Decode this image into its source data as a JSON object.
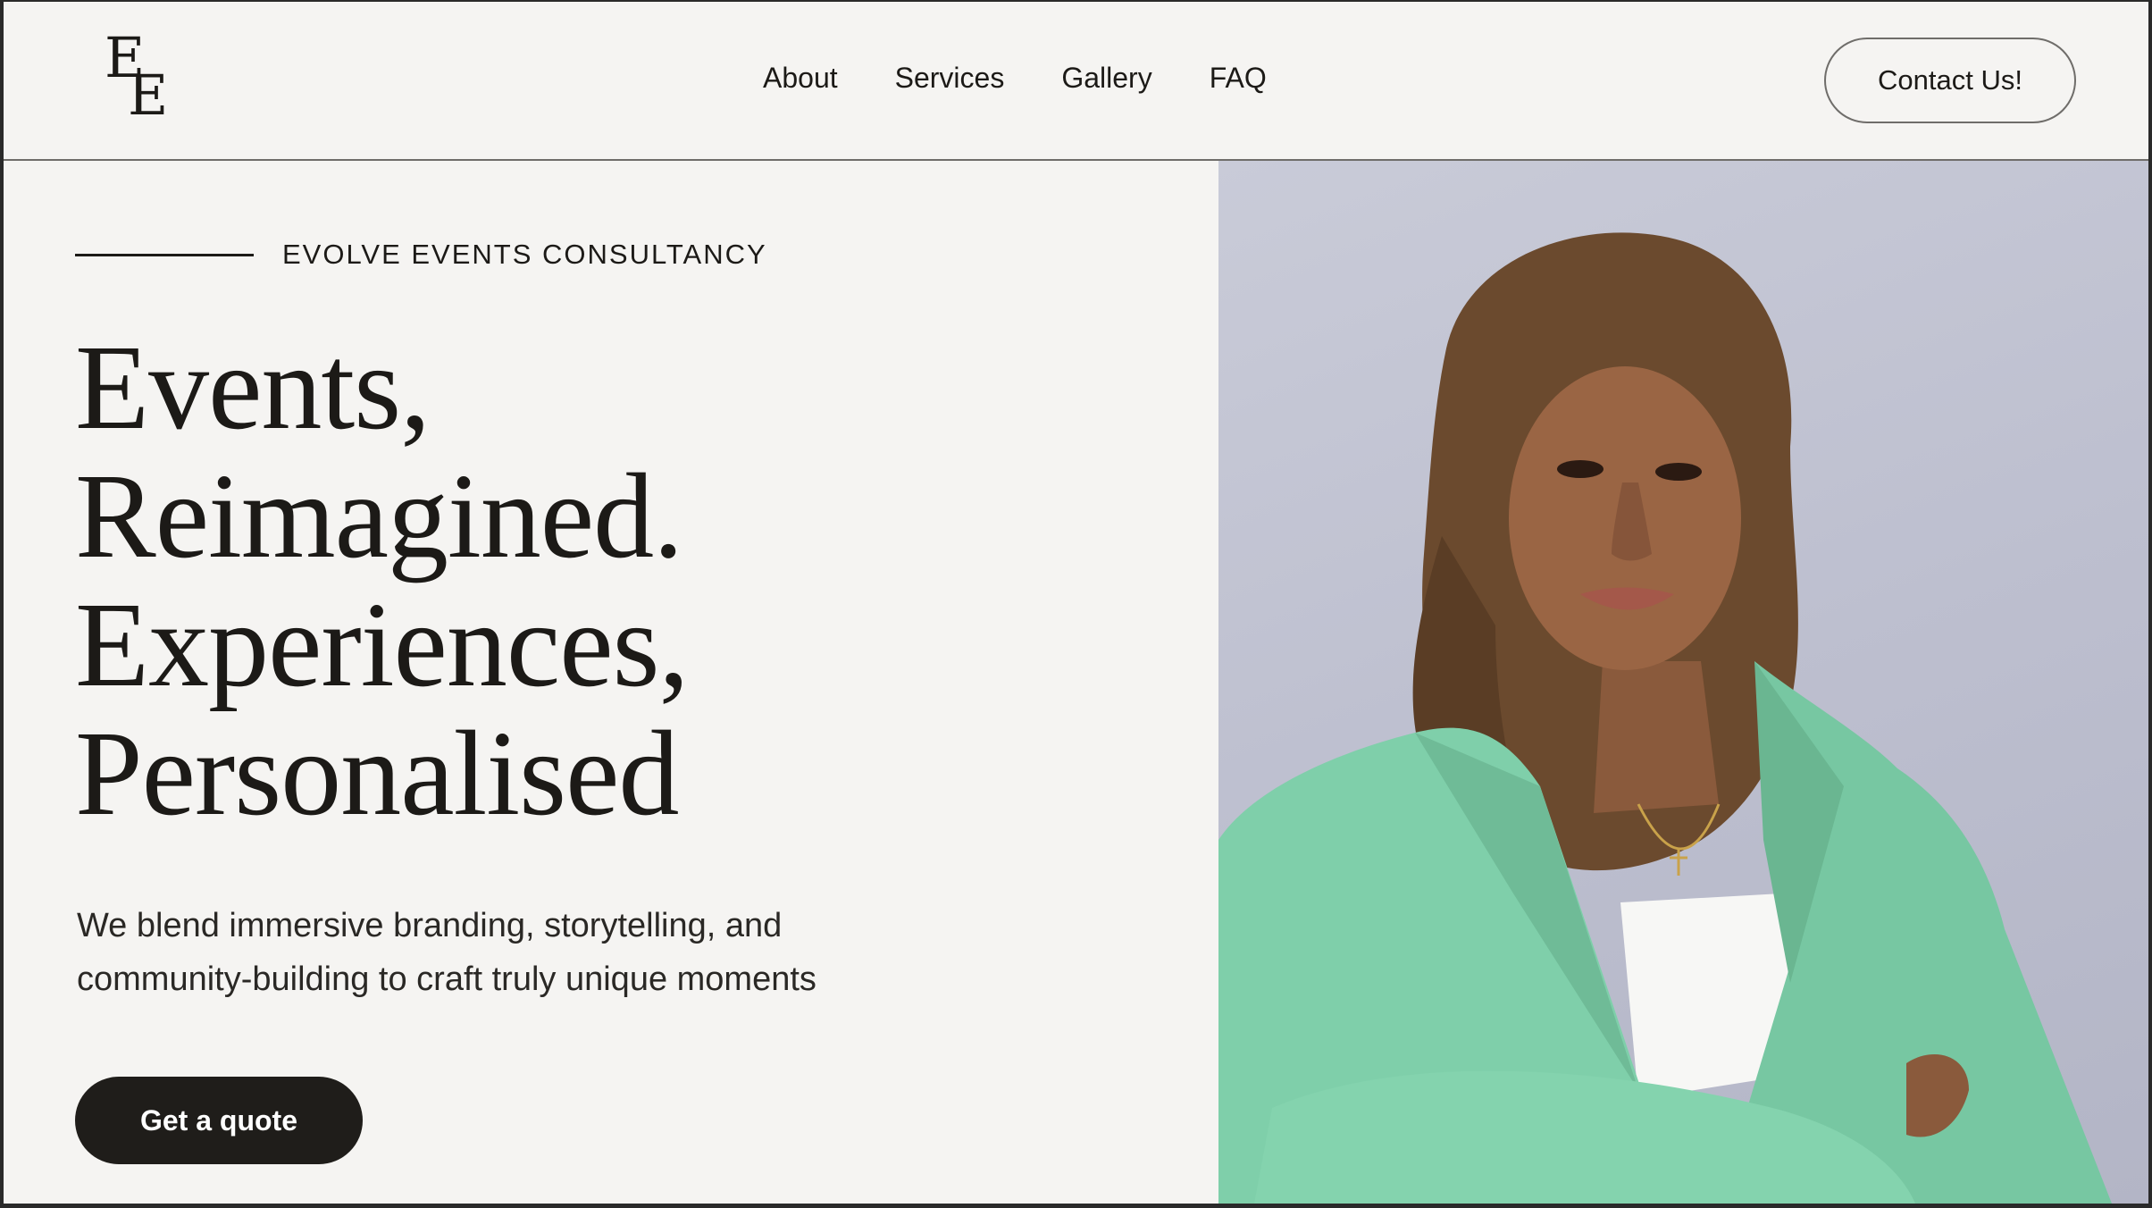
{
  "header": {
    "logo_text": "EE",
    "nav": [
      {
        "label": "About"
      },
      {
        "label": "Services"
      },
      {
        "label": "Gallery"
      },
      {
        "label": "FAQ"
      }
    ],
    "contact_label": "Contact Us!"
  },
  "hero": {
    "eyebrow": "EVOLVE EVENTS CONSULTANCY",
    "headline_lines": [
      "Events,",
      "Reimagined.",
      "Experiences,",
      "Personalised"
    ],
    "subtext": "We blend immersive branding, storytelling, and community-building to craft truly unique moments",
    "cta_label": "Get a quote"
  },
  "colors": {
    "background": "#f5f4f2",
    "text": "#1c1a17",
    "button_dark": "#1f1d1a",
    "photo_backdrop": "#c4c6d4",
    "blazer": "#7fcfaa"
  }
}
